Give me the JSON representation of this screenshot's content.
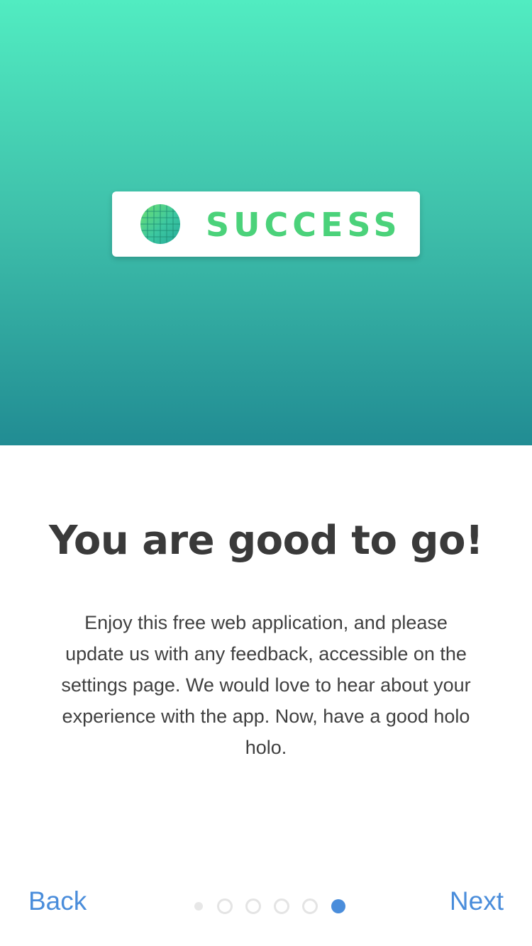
{
  "hero": {
    "badge_text": "SUCCESS",
    "badge_icon": "globe-grid-icon",
    "gradient": [
      "#51ecc1",
      "#218c93"
    ],
    "badge_text_color": "#4bd27a"
  },
  "content": {
    "title": "You are good to go!",
    "body": "Enjoy this free web application, and please update us with any feedback, accessible on the settings page. We would love to hear about your experience with the app. Now, have a good holo holo."
  },
  "navigation": {
    "back_label": "Back",
    "next_label": "Next",
    "accent_color": "#4a8ddb",
    "page_count": 6,
    "current_page": 6
  }
}
